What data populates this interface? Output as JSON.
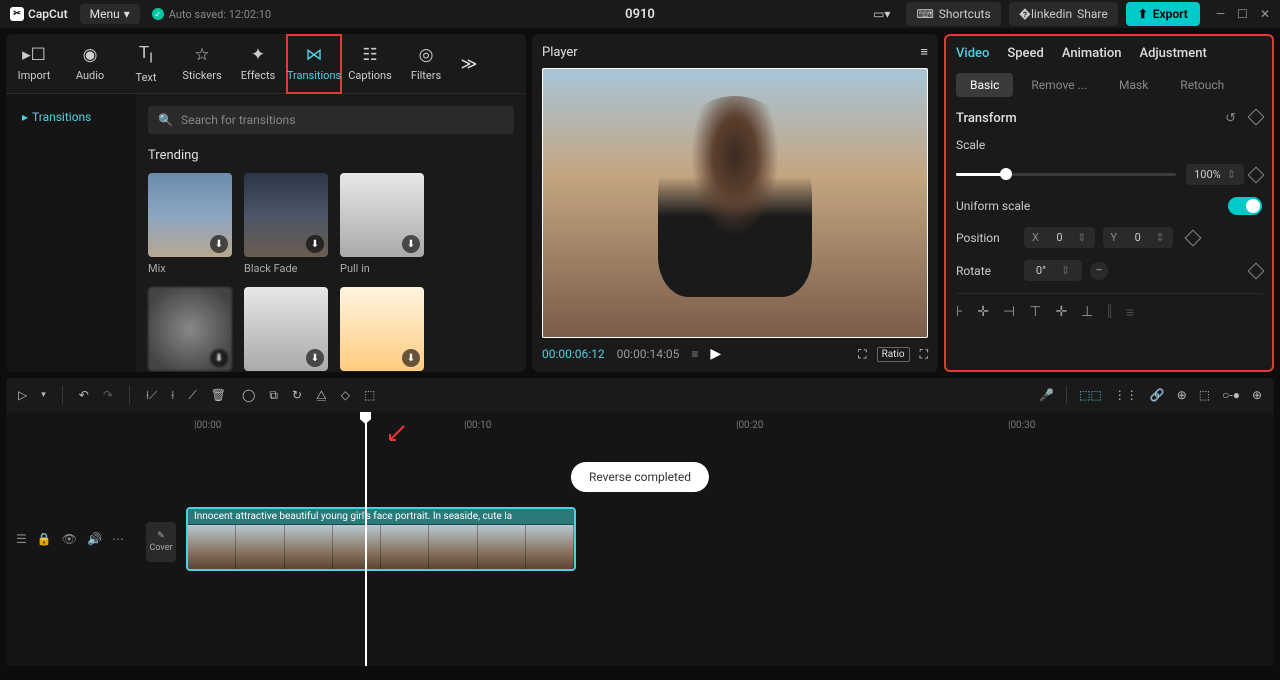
{
  "app": {
    "name": "CapCut",
    "menu": "Menu",
    "autosave": "Auto saved: 12:02:10",
    "project": "0910"
  },
  "topbar": {
    "shortcuts": "Shortcuts",
    "share": "Share",
    "export": "Export"
  },
  "tabs": {
    "import": "Import",
    "audio": "Audio",
    "text": "Text",
    "stickers": "Stickers",
    "effects": "Effects",
    "transitions": "Transitions",
    "captions": "Captions",
    "filters": "Filters"
  },
  "sidenav": {
    "transitions": "Transitions"
  },
  "search": {
    "placeholder": "Search for transitions"
  },
  "trending": {
    "title": "Trending",
    "items": [
      "Mix",
      "Black Fade",
      "Pull in",
      "",
      "",
      ""
    ]
  },
  "player": {
    "title": "Player",
    "current": "00:00:06:12",
    "total": "00:00:14:05",
    "ratio": "Ratio"
  },
  "rpanel": {
    "tabs": {
      "video": "Video",
      "speed": "Speed",
      "animation": "Animation",
      "adjustment": "Adjustment"
    },
    "subtabs": {
      "basic": "Basic",
      "remove": "Remove ...",
      "mask": "Mask",
      "retouch": "Retouch"
    },
    "transform": "Transform",
    "scale": {
      "label": "Scale",
      "value": "100%"
    },
    "uniform": "Uniform scale",
    "position": {
      "label": "Position",
      "x": "X",
      "xval": "0",
      "y": "Y",
      "yval": "0"
    },
    "rotate": {
      "label": "Rotate",
      "value": "0°"
    }
  },
  "ruler": {
    "t0": "|00:00",
    "t10": "|00:10",
    "t20": "|00:20",
    "t30": "|00:30"
  },
  "toast": "Reverse completed",
  "cover": "Cover",
  "clip": {
    "label": "Innocent attractive beautiful young girl's face portrait. In seaside, cute la"
  }
}
